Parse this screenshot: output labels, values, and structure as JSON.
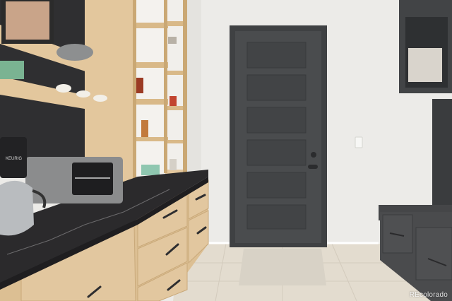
{
  "photo": {
    "subject": "Interior room",
    "coffee_maker_brand": "KEURIG",
    "watermark": "REcolorado",
    "colors": {
      "wall": "#ecebe8",
      "door": "#4a4c4e",
      "door_trim": "#3f4143",
      "cabinet_wood": "#dcbf93",
      "open_shelf_wood": "#e3c79d",
      "countertop": "#2b2a2c",
      "floor_tile": "#e3dccf",
      "bench": "#4a4b4d",
      "mudroom_cubby": "#424446"
    }
  }
}
